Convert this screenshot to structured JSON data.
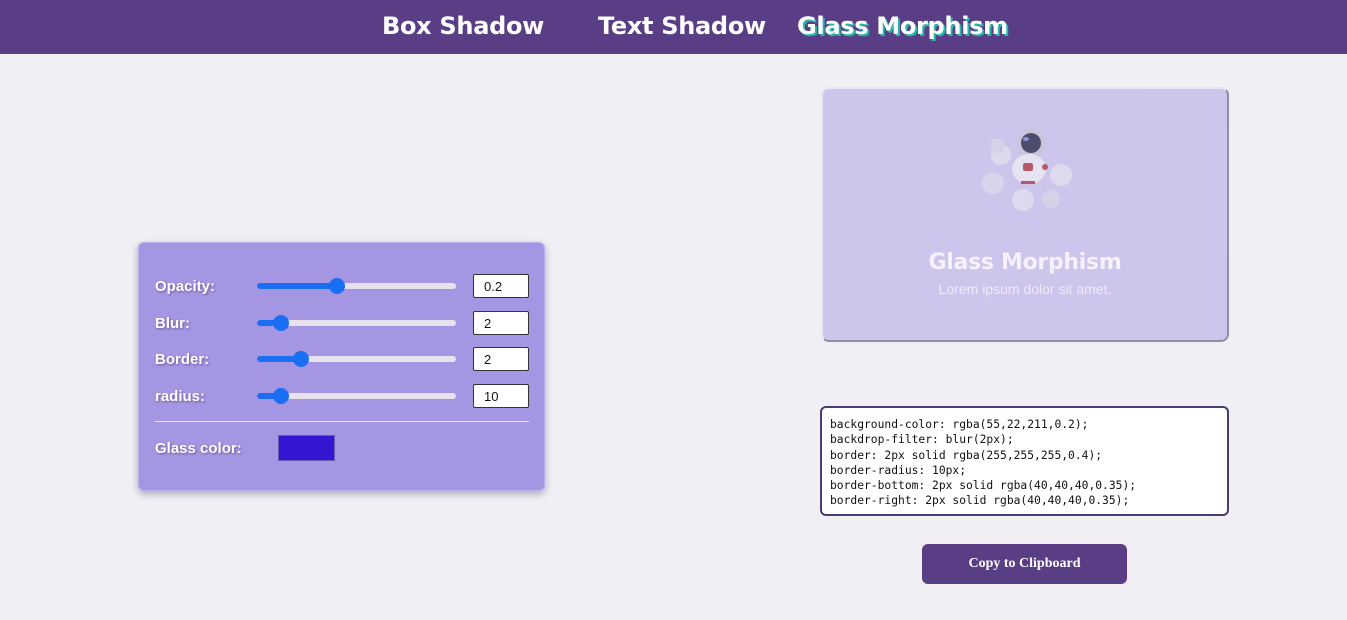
{
  "nav": {
    "tabs": [
      {
        "label": "Box Shadow"
      },
      {
        "label": "Text Shadow"
      },
      {
        "label": "Glass Morphism",
        "active": true
      }
    ]
  },
  "controls": {
    "opacity": {
      "label": "Opacity:",
      "value": "0.2",
      "fraction": 0.4
    },
    "blur": {
      "label": "Blur:",
      "value": "2",
      "fraction": 0.12
    },
    "border": {
      "label": "Border:",
      "value": "2",
      "fraction": 0.22
    },
    "radius": {
      "label": "radius:",
      "value": "10",
      "fraction": 0.12
    },
    "glass_color": {
      "label": "Glass color:",
      "value": "#3716d3"
    }
  },
  "preview": {
    "image": "astronaut-icon",
    "title": "Glass Morphism",
    "subtitle": "Lorem ipsum dolor sit amet."
  },
  "code": {
    "lines": [
      "background-color: rgba(55,22,211,0.2);",
      "backdrop-filter: blur(2px);",
      "border: 2px solid rgba(255,255,255,0.4);",
      "border-radius: 10px;",
      "border-bottom: 2px solid rgba(40,40,40,0.35);",
      "border-right: 2px solid rgba(40,40,40,0.35);"
    ]
  },
  "copy_button": {
    "label": "Copy to Clipboard"
  },
  "colors": {
    "nav_bg": "#5a3e85",
    "panel_bg": "#a596e3",
    "slider_accent": "#1a6ef2",
    "preview_bg": "#cdc5ec",
    "active_tab_shadow": "#27b6a8"
  }
}
